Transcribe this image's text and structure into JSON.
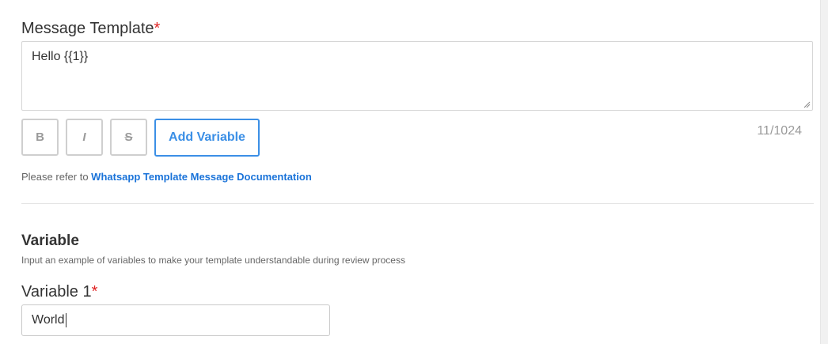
{
  "message_template": {
    "label": "Message Template",
    "required_mark": "*",
    "value": "Hello {{1}}",
    "char_count": "11/1024"
  },
  "toolbar": {
    "bold_label": "B",
    "italic_label": "I",
    "strike_label": "S",
    "add_variable_label": "Add Variable"
  },
  "reference": {
    "prefix": "Please refer to",
    "link_text": "Whatsapp Template Message Documentation"
  },
  "variable_section": {
    "title": "Variable",
    "description": "Input an example of variables to make your template understandable during review process",
    "variables": [
      {
        "label": "Variable 1",
        "required_mark": "*",
        "value": "World"
      }
    ]
  },
  "colors": {
    "accent": "#3b8fe6",
    "link": "#1a73d9",
    "required": "#e02424"
  }
}
